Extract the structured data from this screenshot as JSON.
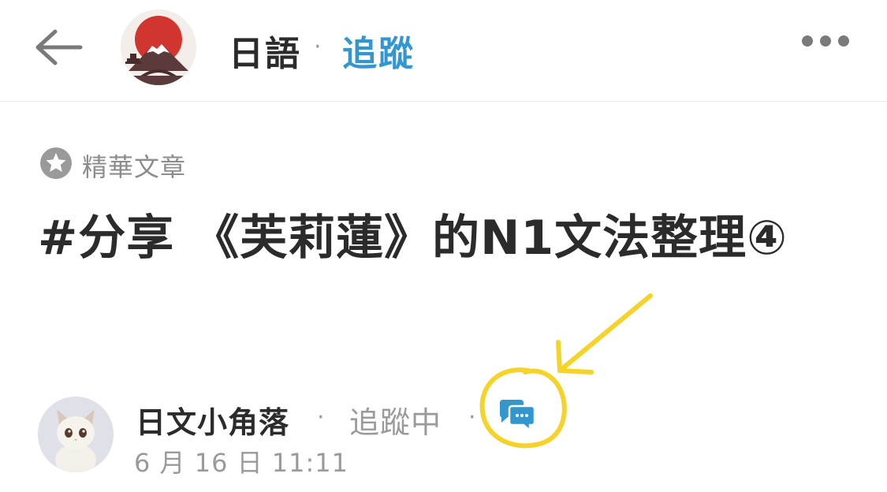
{
  "header": {
    "back_icon": "back-arrow-icon",
    "board_avatar_icon": "mount-fuji-icon",
    "board_name": "日語",
    "separator": "·",
    "follow_label": "追蹤",
    "more_icon": "more-dots-icon"
  },
  "post": {
    "featured_icon": "star-icon",
    "featured_label": "精華文章",
    "title": "#分享 《芙莉蓮》的N1文法整理④"
  },
  "author": {
    "avatar_icon": "cat-avatar",
    "name": "日文小角落",
    "separator": "·",
    "follow_status": "追蹤中",
    "comment_icon": "chat-bubbles-icon",
    "date": "6 月 16 日 11:11"
  },
  "colors": {
    "accent": "#3397cf",
    "text": "#2b2b2b",
    "muted": "#9a9a9a",
    "annotation": "#f5d32a"
  }
}
